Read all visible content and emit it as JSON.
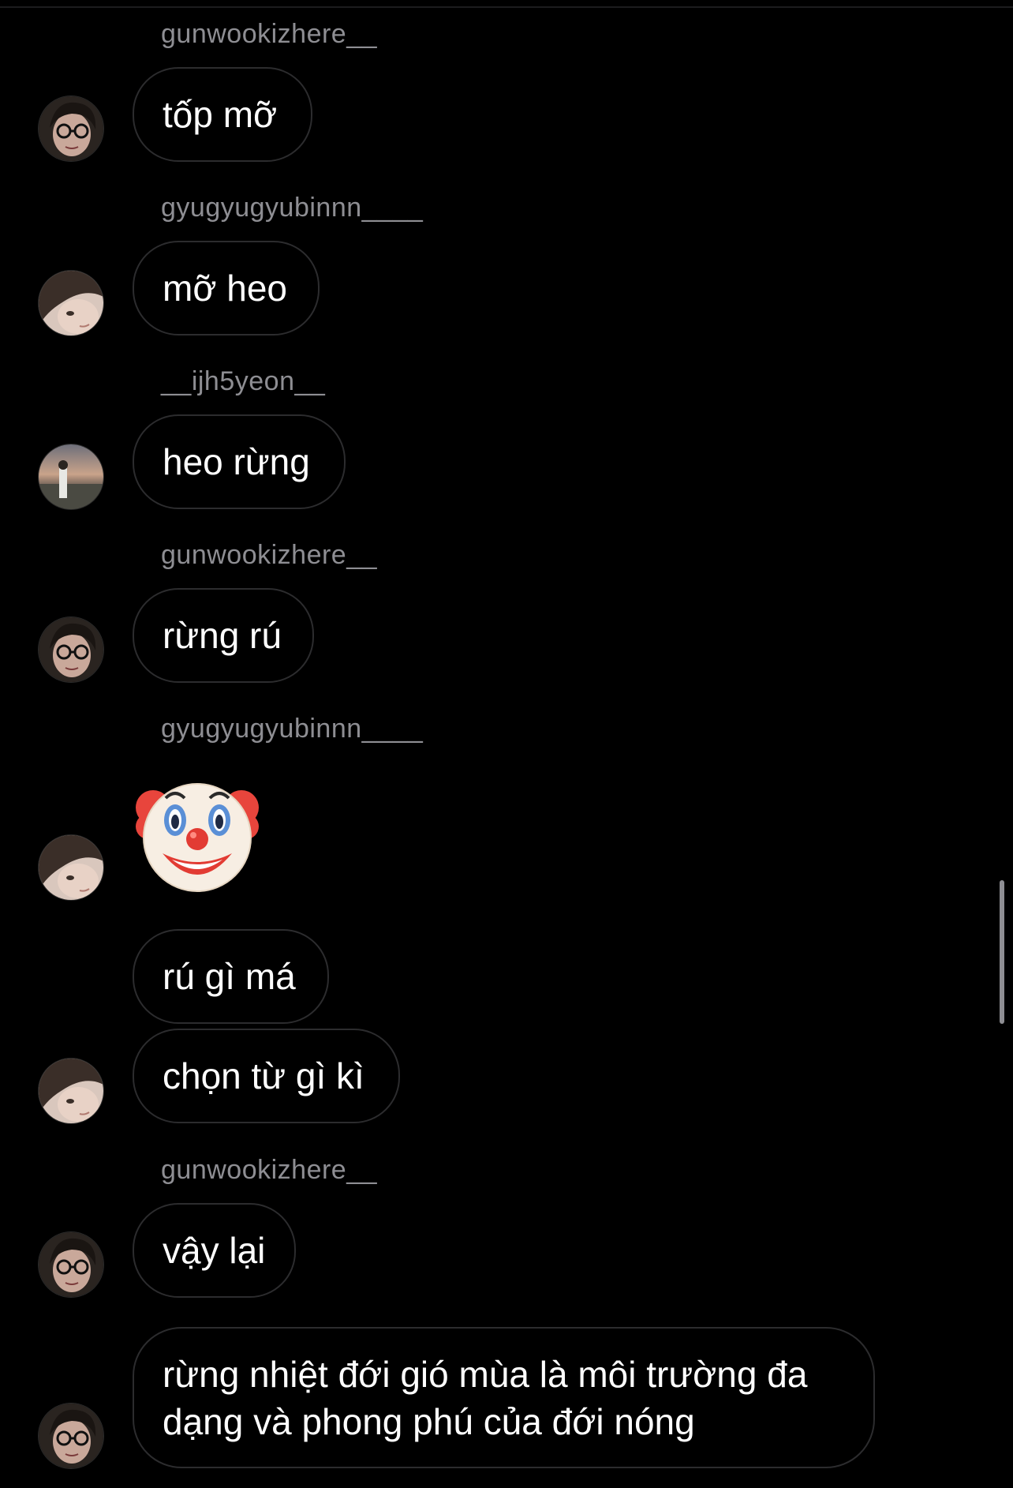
{
  "colors": {
    "background": "#000000",
    "bubble_border": "#2c2c2e",
    "username": "#8e8e93",
    "text": "#ffffff"
  },
  "messages": [
    {
      "username": "gunwookizhere__",
      "text": "tốp mỡ",
      "avatar": "avatar-gunwookizhere"
    },
    {
      "username": "gyugyugyubinnn____",
      "text": "mỡ heo",
      "avatar": "avatar-gyugyugyubinnn"
    },
    {
      "username": "__ijh5yeon__",
      "text": "heo rừng",
      "avatar": "avatar-ijh5yeon"
    },
    {
      "username": "gunwookizhere__",
      "text": "rừng rú",
      "avatar": "avatar-gunwookizhere"
    },
    {
      "username": "gyugyugyubinnn____",
      "emoji": "clown-face-emoji",
      "avatar": "avatar-gyugyugyubinnn"
    },
    {
      "text": "rú gì má"
    },
    {
      "text": "chọn từ gì kì",
      "avatar": "avatar-gyugyugyubinnn"
    },
    {
      "username": "gunwookizhere__",
      "text": "vậy lại",
      "avatar": "avatar-gunwookizhere"
    },
    {
      "text": "rừng nhiệt đới gió mùa là môi trường đa dạng và phong phú của đới nóng",
      "avatar": "avatar-gunwookizhere"
    }
  ]
}
